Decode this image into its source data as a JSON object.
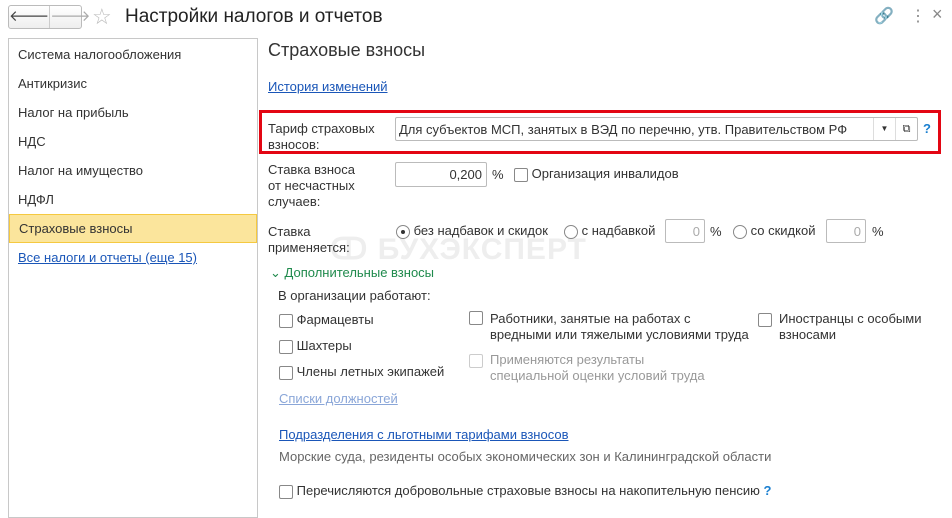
{
  "window": {
    "title": "Настройки налогов и отчетов",
    "back": "🡐",
    "forward": "🡒"
  },
  "sidebar": {
    "items": [
      {
        "label": "Система налогообложения"
      },
      {
        "label": "Антикризис"
      },
      {
        "label": "Налог на прибыль"
      },
      {
        "label": "НДС"
      },
      {
        "label": "Налог на имущество"
      },
      {
        "label": "НДФЛ"
      },
      {
        "label": "Страховые взносы"
      }
    ],
    "all_link": "Все налоги и отчеты (еще 15)"
  },
  "main": {
    "heading": "Страховые взносы",
    "history_link": "История изменений",
    "tariff_label": "Тариф страховых взносов:",
    "tariff_value": "Для субъектов МСП, занятых в ВЭД по перечню, утв. Правительством РФ",
    "help": "?",
    "rate_label": "Ставка взноса от несчастных случаев:",
    "rate_value": "0,200",
    "percent": "%",
    "invalid_org": "Организация инвалидов",
    "applied_label": "Ставка применяется:",
    "opt_none": "без надбавок и скидок",
    "opt_markup": "с надбавкой",
    "opt_markup_value": "0",
    "opt_discount": "со скидкой",
    "opt_discount_value": "0",
    "additional": "Дополнительные взносы",
    "org_works": "В организации работают:",
    "pharm": "Фармацевты",
    "miners": "Шахтеры",
    "flight": "Члены летных экипажей",
    "hazard": "Работники, занятые на работах с вредными или тяжелыми условиями труда",
    "special_eval": "Применяются результаты специальной оценки условий труда",
    "foreigners": "Иностранцы с особыми взносами",
    "positions_link": "Списки должностей",
    "subdiv_link": "Подразделения с льготными тарифами взносов",
    "subdiv_note": "Морские суда, резиденты особых экономических зон и Калининградской области",
    "voluntary": "Перечисляются добровольные страховые взносы на накопительную пенсию"
  },
  "watermark": "БУХЭКСПЕРТ",
  "colors": {
    "highlight": "#e30613",
    "link": "#1a56b8",
    "green": "#1f8a4c",
    "active": "#fbe59c"
  }
}
